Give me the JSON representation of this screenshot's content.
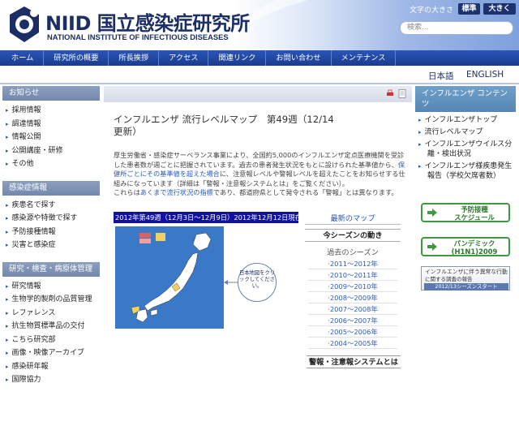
{
  "header": {
    "logo_big": "NIID 国立感染症研究所",
    "logo_small": "NATIONAL INSTITUTE OF INFECTIOUS DISEASES",
    "fontsize_label": "文字の大きさ",
    "fontsize_standard": "標準",
    "fontsize_large": "大きく",
    "search_placeholder": "検索..."
  },
  "nav": {
    "items": [
      "ホーム",
      "研究所の概要",
      "所長挨拶",
      "アクセス",
      "関連リンク",
      "お問い合わせ",
      "メンテナンス"
    ]
  },
  "language": {
    "japanese": "日本語",
    "english": "ENGLISH"
  },
  "sidebar_left": {
    "sections": [
      {
        "title": "お知らせ",
        "items": [
          "採用情報",
          "調達情報",
          "情報公開",
          "公開講座・研修",
          "その他"
        ]
      },
      {
        "title": "感染症情報",
        "items": [
          "疾患名で探す",
          "感染源や特徴で探す",
          "予防接種情報",
          "災害と感染症"
        ]
      },
      {
        "title": "研究・検査・病原体管理",
        "items": [
          "研究情報",
          "生物学的製剤の品質管理",
          "レファレンス",
          "抗生物質標準品の交付",
          "こちら研究部",
          "画像・映像アーカイブ",
          "感染研年報",
          "国際協力"
        ]
      }
    ]
  },
  "main": {
    "title_line1": "インフルエンザ 流行レベルマップ　第49週（12/14",
    "title_line2": "更新）",
    "body1_a": "厚生労働省・感染症サーベランス事業により、全国約5,000のインフルエンザ定点医療機関を受診した患者数が週ごとに把握されています。過去の患者発生状況をもとに設けられた基準値から、",
    "body1_link": "保健所ごとにその基準値を超えた場合",
    "body1_b": "に、注意報レベルや警報レベルを超えたことをお知らせする仕組みになっています（詳細は「警報・注意報システムとは」をご覧ください）。",
    "body2_a": "これらは",
    "body2_link": "あくまで流行状況の指標",
    "body2_b": "であり、都道府県として発令される「警報」とは異なります。",
    "map_banner": "2012年第49週（12月3日〜12月9日）2012年12月12日現在",
    "map_note": "日本地図をクリックしてください。",
    "latest_map": "最新のマップ",
    "this_season": "今シーズンの動き",
    "past_seasons_label": "過去のシーズン",
    "past_seasons": [
      "2011～2012年",
      "2010～2011年",
      "2009～2010年",
      "2008～2009年",
      "2007～2008年",
      "2006～2007年",
      "2005～2006年",
      "2004～2005年"
    ],
    "alert_system": "警報・注意報システムとは"
  },
  "sidebar_right": {
    "title": "インフルエンザ コンテンツ",
    "items": [
      {
        "line1": "インフルエンザトップ",
        "line2": ""
      },
      {
        "line1": "流行レベルマップ",
        "line2": ""
      },
      {
        "line1": "インフルエンザウイルス分",
        "line2": "離・検出状況"
      },
      {
        "line1": "インフルエンザ様疾患発生",
        "line2": "報告（学校欠席者数）"
      }
    ],
    "btn1_line1": "予防接種",
    "btn1_line2": "スケジュール",
    "btn2_line1": "パンデミック",
    "btn2_line2": "(H1N1)2009",
    "banner_line1": "インフルエンザに伴う異常な行動",
    "banner_line2": "に関する調査の報告",
    "banner_line3": "2012/13シーズンスタート"
  }
}
